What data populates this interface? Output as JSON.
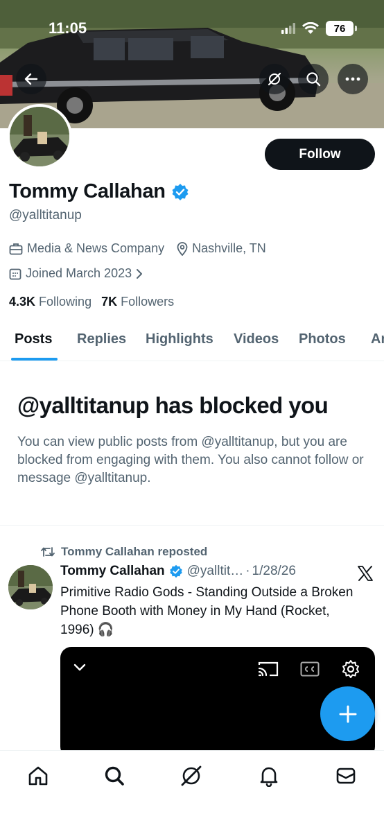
{
  "status_bar": {
    "time": "11:05",
    "battery": "76"
  },
  "profile": {
    "name": "Tommy Callahan",
    "handle": "@yalltitanup",
    "category": "Media & News Company",
    "location": "Nashville, TN",
    "joined": "Joined March 2023",
    "following_count": "4.3K",
    "following_label": "Following",
    "followers_count": "7K",
    "followers_label": "Followers",
    "follow_label": "Follow"
  },
  "tabs": [
    "Posts",
    "Replies",
    "Highlights",
    "Videos",
    "Photos",
    "Ar"
  ],
  "blocked": {
    "title": "@yalltitanup has blocked you",
    "description": "You can view public posts from @yalltitanup, but you are blocked from engaging with them. You also cannot follow or message @yalltitanup."
  },
  "post": {
    "repost_label": "Tommy Callahan reposted",
    "author": "Tommy Callahan",
    "handle": "@yalltit…",
    "separator": "·",
    "date": "1/28/26",
    "text": "Primitive Radio Gods - Standing Outside a Broken Phone Booth with Money in My Hand (Rocket, 1996) 🎧"
  },
  "colors": {
    "accent": "#1d9bf0",
    "text": "#0f1419",
    "secondary": "#536471"
  },
  "icons": {
    "back": "back-arrow-icon",
    "grok": "grok-icon",
    "search": "search-icon",
    "more": "more-icon",
    "verified": "verified-badge-icon",
    "briefcase": "briefcase-icon",
    "location": "location-pin-icon",
    "calendar": "calendar-icon",
    "repost": "repost-icon",
    "x": "x-logo-icon",
    "compose": "plus-icon",
    "home": "home-icon",
    "notifications": "bell-icon",
    "messages": "mail-icon"
  }
}
